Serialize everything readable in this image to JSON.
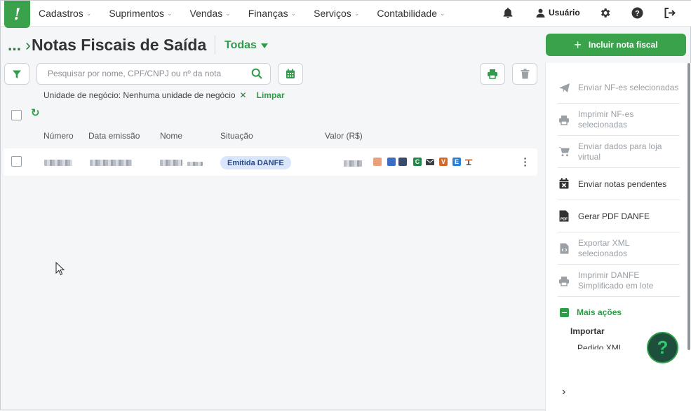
{
  "nav": {
    "logo": "!",
    "menu": [
      {
        "label": "Cadastros"
      },
      {
        "label": "Suprimentos"
      },
      {
        "label": "Vendas"
      },
      {
        "label": "Finanças"
      },
      {
        "label": "Serviços"
      },
      {
        "label": "Contabilidade"
      }
    ],
    "user_label": "Usuário",
    "icons": [
      "bell-icon",
      "user-icon",
      "gear-icon",
      "help-circle-icon",
      "logout-icon"
    ]
  },
  "header": {
    "breadcrumb": "...",
    "title": "Notas Fiscais de Saída",
    "filter_label": "Todas",
    "primary_button": "Incluir nota fiscal"
  },
  "toolbar": {
    "search_placeholder": "Pesquisar por nome, CPF/CNPJ ou nº da nota",
    "active_filter": "Unidade de negócio: Nenhuma unidade de negócio",
    "clear_label": "Limpar"
  },
  "table": {
    "columns": [
      "Número",
      "Data emissão",
      "Nome",
      "Situação",
      "Valor (R$)"
    ],
    "rows": [
      {
        "status": "Emitida DANFE",
        "status_icons": [
          "C",
          "V",
          "E"
        ]
      }
    ]
  },
  "actions_panel": {
    "items": [
      {
        "label": "Enviar NF-es selecionadas",
        "enabled": false,
        "icon": "paper-plane-icon"
      },
      {
        "label": "Imprimir NF-es selecionadas",
        "enabled": false,
        "icon": "printer-icon"
      },
      {
        "label": "Enviar dados para loja virtual",
        "enabled": false,
        "icon": "cart-icon"
      },
      {
        "label": "Enviar notas pendentes",
        "enabled": true,
        "icon": "calendar-x-icon"
      },
      {
        "label": "Gerar PDF DANFE",
        "enabled": true,
        "icon": "pdf-file-icon"
      },
      {
        "label": "Exportar XML selecionados",
        "enabled": false,
        "icon": "code-file-icon"
      },
      {
        "label": "Imprimir DANFE Simplificado em lote",
        "enabled": false,
        "icon": "printer-icon"
      }
    ],
    "more_label": "Mais ações",
    "import_heading": "Importar",
    "import_item": "Pedido XML"
  },
  "colors": {
    "brand_green": "#3aa24b",
    "status_badge_bg": "#d9e6fb",
    "help_bg": "#1d4f3c"
  }
}
